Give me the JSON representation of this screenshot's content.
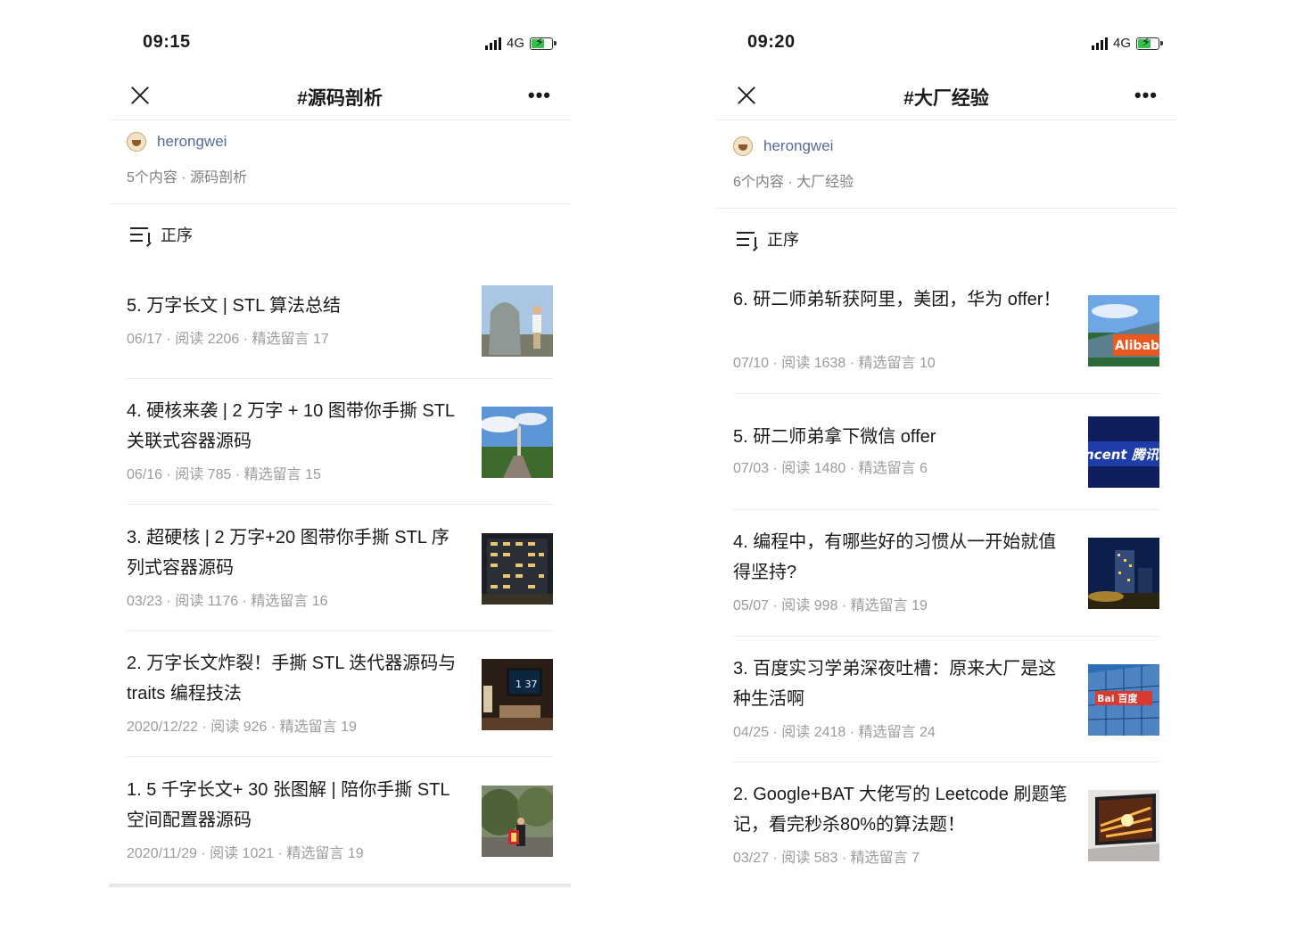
{
  "left": {
    "time": "09:15",
    "network": "4G",
    "title": "#源码剖析",
    "author": "herongwei",
    "meta": "5个内容 · 源码剖析",
    "sort_label": "正序",
    "items": [
      {
        "title": "5. 万字长文 | STL 算法总结",
        "info": "06/17 · 阅读 2206 · 精选留言 17"
      },
      {
        "title": "4. 硬核来袭 | 2 万字 + 10 图带你手撕 STL 关联式容器源码",
        "info": "06/16 · 阅读 785 · 精选留言 15"
      },
      {
        "title": "3. 超硬核 | 2 万字+20 图带你手撕 STL 序列式容器源码",
        "info": "03/23 · 阅读 1176 · 精选留言 16"
      },
      {
        "title": "2. 万字长文炸裂！手撕 STL 迭代器源码与 traits 编程技法",
        "info": "2020/12/22 · 阅读 926 · 精选留言 19"
      },
      {
        "title": "1. 5 千字长文+ 30 张图解 | 陪你手撕 STL 空间配置器源码",
        "info": "2020/11/29 · 阅读 1021 · 精选留言 19"
      }
    ]
  },
  "right": {
    "time": "09:20",
    "network": "4G",
    "title": "#大厂经验",
    "author": "herongwei",
    "meta": "6个内容 · 大厂经验",
    "sort_label": "正序",
    "items": [
      {
        "title": "6. 研二师弟斩获阿里，美团，华为 offer！",
        "info": "07/10 · 阅读 1638 · 精选留言 10",
        "thumb_text": "Alibaba"
      },
      {
        "title": "5. 研二师弟拿下微信 offer",
        "info": "07/03 · 阅读 1480 · 精选留言 6",
        "thumb_text": "ncent 腾讯"
      },
      {
        "title": "4. 编程中，有哪些好的习惯从一开始就值得坚持?",
        "info": "05/07 · 阅读 998 · 精选留言 19"
      },
      {
        "title": "3. 百度实习学弟深夜吐槽：原来大厂是这种生活啊",
        "info": "04/25 · 阅读 2418 · 精选留言 24",
        "thumb_text": "Bai 百度"
      },
      {
        "title": "2. Google+BAT 大佬写的 Leetcode 刷题笔记，看完秒杀80%的算法题！",
        "info": "03/27 · 阅读 583 · 精选留言 7"
      }
    ]
  },
  "icons": [
    "close-icon",
    "more-icon",
    "sort-icon",
    "signal-icon",
    "battery-icon",
    "avatar"
  ]
}
